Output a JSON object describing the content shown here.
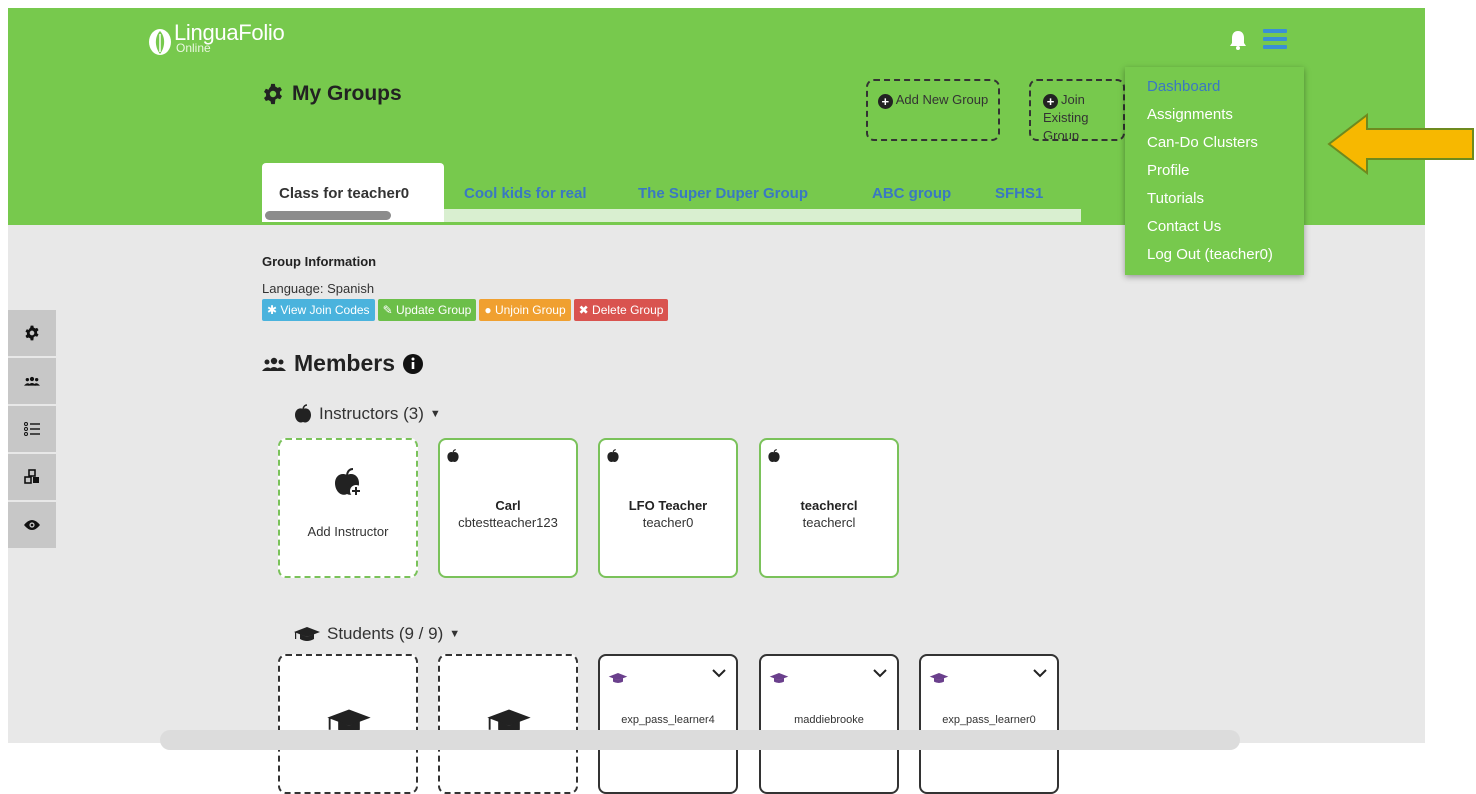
{
  "app": {
    "logo_text": "LinguaFolio",
    "logo_sub": "Online"
  },
  "page": {
    "title": "My Groups"
  },
  "actions": {
    "add_group": "Add New Group",
    "join_group": "Join Existing Group"
  },
  "tabs": [
    {
      "label": "Class for teacher0",
      "active": true
    },
    {
      "label": "Cool kids for real"
    },
    {
      "label": "The Super Duper Group"
    },
    {
      "label": "ABC group"
    },
    {
      "label": "SFHS1"
    }
  ],
  "menu": {
    "items": [
      {
        "label": "Dashboard",
        "active": true
      },
      {
        "label": "Assignments"
      },
      {
        "label": "Can-Do Clusters"
      },
      {
        "label": "Profile"
      },
      {
        "label": "Tutorials"
      },
      {
        "label": "Contact Us"
      },
      {
        "label": "Log Out (teacher0)"
      }
    ]
  },
  "group_info": {
    "title": "Group Information",
    "language": "Language: Spanish",
    "buttons": [
      {
        "label": "View Join Codes",
        "color": "#4ab3dd",
        "icon": "asterisk-icon"
      },
      {
        "label": "Update Group",
        "color": "#6cbf49",
        "icon": "pencil-icon"
      },
      {
        "label": "Unjoin Group",
        "color": "#f0a030",
        "icon": "info-icon"
      },
      {
        "label": "Delete Group",
        "color": "#d9534f",
        "icon": "x-icon"
      }
    ]
  },
  "members": {
    "title": "Members",
    "instructors_header": "Instructors (3)",
    "add_instructor": "Add Instructor",
    "instructors": [
      {
        "name": "Carl",
        "username": "cbtestteacher123"
      },
      {
        "name": "LFO Teacher",
        "username": "teacher0"
      },
      {
        "name": "teachercl",
        "username": "teachercl"
      }
    ],
    "students_header": "Students (9 / 9)",
    "students": [
      {
        "username": "exp_pass_learner4"
      },
      {
        "username": "maddiebrooke"
      },
      {
        "username": "exp_pass_learner0"
      }
    ]
  },
  "colors": {
    "header_green": "#77c94d",
    "link_blue": "#3a78c2",
    "arrow": "#f7b800",
    "student_cap": "#6a3f8c"
  }
}
